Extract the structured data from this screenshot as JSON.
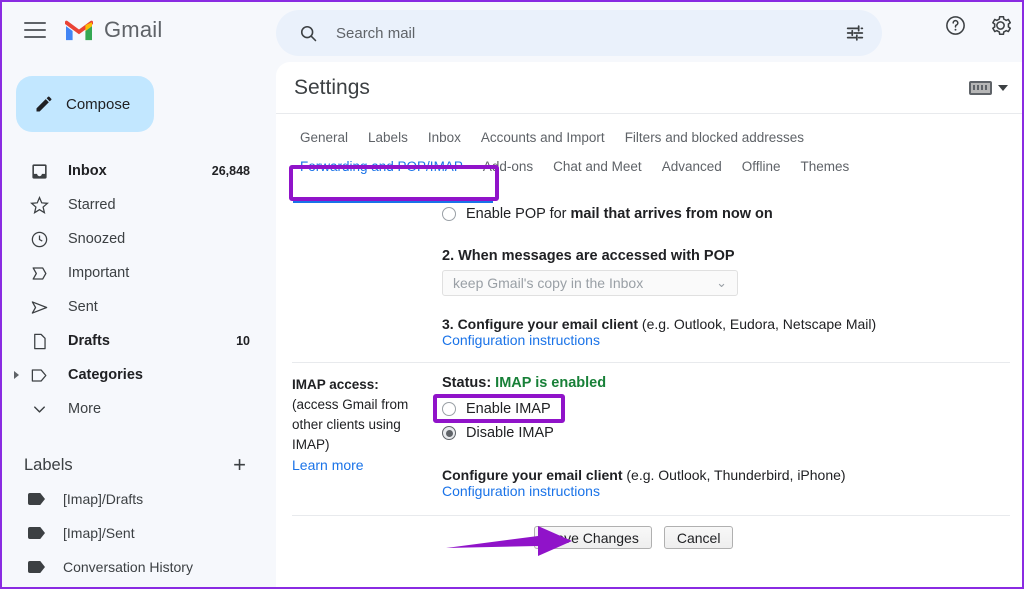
{
  "brand": {
    "name": "Gmail",
    "menu_icon": "hamburger-menu-icon",
    "logo_icon": "gmail-logo-icon"
  },
  "compose": {
    "label": "Compose",
    "icon": "pencil-icon"
  },
  "search": {
    "placeholder": "Search mail",
    "icon": "search-icon",
    "filter_icon": "tune-filter-icon"
  },
  "topicons": {
    "help": "help-icon",
    "settings": "gear-icon"
  },
  "sidebar": {
    "items": [
      {
        "label": "Inbox",
        "count": "26,848",
        "icon": "inbox-icon",
        "bold": true
      },
      {
        "label": "Starred",
        "count": "",
        "icon": "star-icon",
        "bold": false
      },
      {
        "label": "Snoozed",
        "count": "",
        "icon": "clock-icon",
        "bold": false
      },
      {
        "label": "Important",
        "count": "",
        "icon": "important-chevron-icon",
        "bold": false
      },
      {
        "label": "Sent",
        "count": "",
        "icon": "send-icon",
        "bold": false
      },
      {
        "label": "Drafts",
        "count": "10",
        "icon": "draft-page-icon",
        "bold": true
      },
      {
        "label": "Categories",
        "count": "",
        "icon": "tag-icon",
        "bold": true
      },
      {
        "label": "More",
        "count": "",
        "icon": "chevron-down-icon",
        "bold": false
      }
    ],
    "labels_header": "Labels",
    "add_label": "+",
    "labels": [
      {
        "label": "[Imap]/Drafts"
      },
      {
        "label": "[Imap]/Sent"
      },
      {
        "label": "Conversation History"
      }
    ]
  },
  "settings": {
    "title": "Settings",
    "keyboard_icon": "keyboard-icon",
    "tabs_row1": [
      {
        "label": "General",
        "active": false
      },
      {
        "label": "Labels",
        "active": false
      },
      {
        "label": "Inbox",
        "active": false
      },
      {
        "label": "Accounts and Import",
        "active": false
      },
      {
        "label": "Filters and blocked addresses",
        "active": false
      }
    ],
    "tabs_row2": [
      {
        "label": "Forwarding and POP/IMAP",
        "active": true
      },
      {
        "label": "Add-ons",
        "active": false
      },
      {
        "label": "Chat and Meet",
        "active": false
      },
      {
        "label": "Advanced",
        "active": false
      },
      {
        "label": "Offline",
        "active": false
      },
      {
        "label": "Themes",
        "active": false
      }
    ]
  },
  "pop": {
    "enable_now_prefix": "Enable POP for ",
    "enable_now_bold": "mail that arrives from now on",
    "step2_title": "2. When messages are accessed with POP",
    "step2_select_value": "keep Gmail's copy in the Inbox",
    "step3_bold": "3. Configure your email client",
    "step3_rest": " (e.g. Outlook, Eudora, Netscape Mail)",
    "config_link": "Configuration instructions"
  },
  "imap": {
    "section_label": "IMAP access:",
    "section_desc": "(access Gmail from other clients using IMAP)",
    "learn_more": "Learn more",
    "status_prefix": "Status: ",
    "status_value": "IMAP is enabled",
    "enable_label": "Enable IMAP",
    "disable_label": "Disable IMAP",
    "configure_bold": "Configure your email client",
    "configure_rest": " (e.g. Outlook, Thunderbird, iPhone)",
    "config_link": "Configuration instructions"
  },
  "actions": {
    "save_label": "Save Changes",
    "cancel_label": "Cancel"
  },
  "annotations": {
    "highlight_color": "#9013c9",
    "arrow_color": "#9013c9",
    "accent_blue": "#1a73e8",
    "status_green": "#188038"
  }
}
